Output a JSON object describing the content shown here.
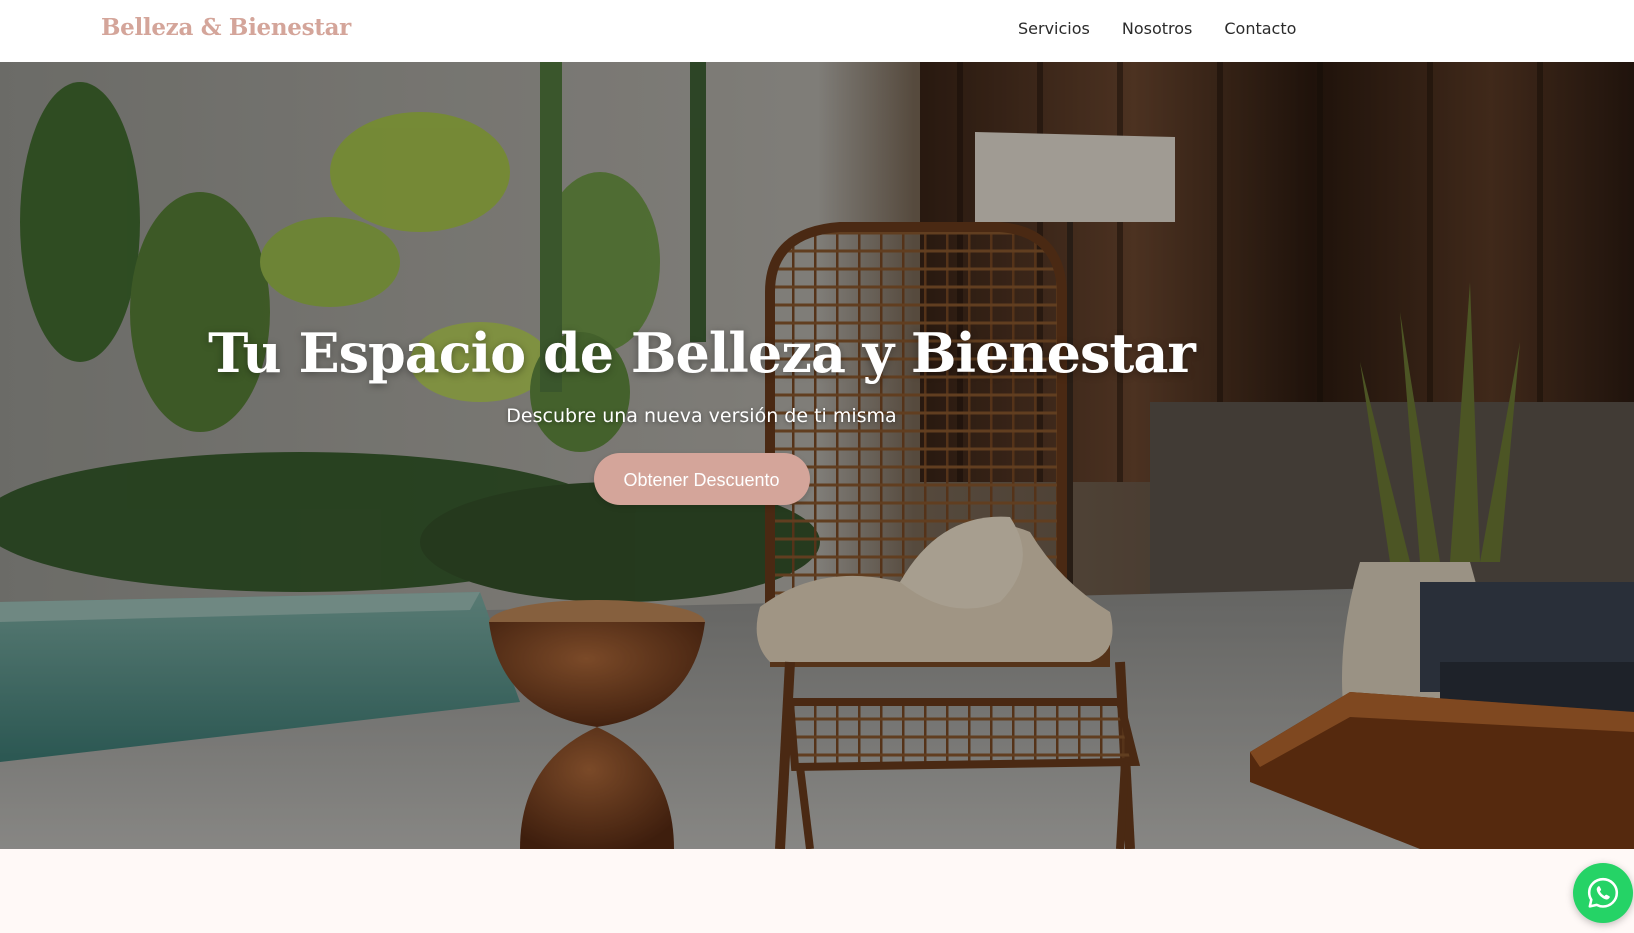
{
  "header": {
    "brand": "Belleza & Bienestar",
    "nav": [
      {
        "label": "Servicios"
      },
      {
        "label": "Nosotros"
      },
      {
        "label": "Contacto"
      }
    ]
  },
  "hero": {
    "title": "Tu Espacio de Belleza y Bienestar",
    "subtitle": "Descubre una nueva versión de ti misma",
    "cta_label": "Obtener Descuento",
    "background_image": "spa lounge with rattan chair, plants and plunge pool"
  },
  "floating": {
    "whatsapp_icon": "whatsapp-icon"
  },
  "colors": {
    "brand": "#d4a59a",
    "cta": "#d4a59a",
    "whatsapp": "#25d366",
    "page_background": "#fff9f7",
    "nav_text": "#2b2b2b"
  }
}
